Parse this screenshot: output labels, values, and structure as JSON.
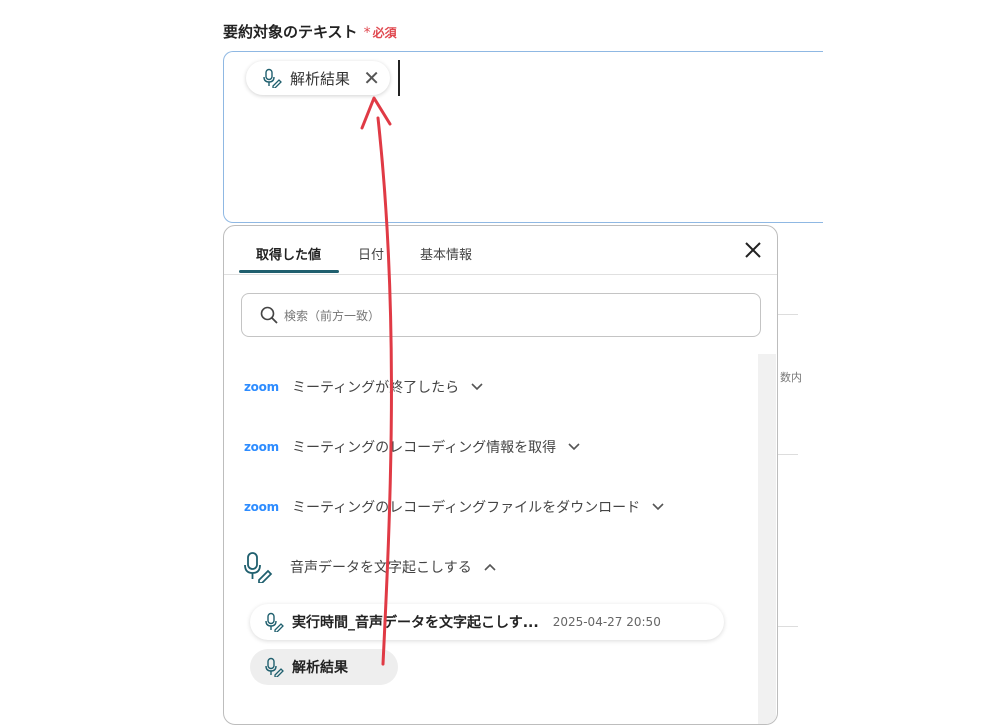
{
  "field": {
    "label": "要約対象のテキスト",
    "required_star": "*",
    "required_text": "必須",
    "chip_label": "解析結果"
  },
  "background": {
    "partial_text": "数内"
  },
  "panel": {
    "tabs": [
      {
        "label": "取得した値",
        "active": true
      },
      {
        "label": "日付",
        "active": false
      },
      {
        "label": "基本情報",
        "active": false
      }
    ],
    "search_placeholder": "検索（前方一致）",
    "groups": [
      {
        "logo": "zoom",
        "label": "ミーティングが終了したら",
        "expanded": false
      },
      {
        "logo": "zoom",
        "label": "ミーティングのレコーディング情報を取得",
        "expanded": false
      },
      {
        "logo": "zoom",
        "label": "ミーティングのレコーディングファイルをダウンロード",
        "expanded": false
      },
      {
        "logo": "mic-pen-icon",
        "label": "音声データを文字起こしする",
        "expanded": true
      }
    ],
    "items": [
      {
        "label": "実行時間_音声データを文字起こしす...",
        "timestamp": "2025-04-27 20:50"
      },
      {
        "label": "解析結果"
      }
    ]
  },
  "colors": {
    "accent": "#1f5f6e",
    "required": "#e0484f",
    "arrow": "#e03a45",
    "zoom": "#2d8cff",
    "field_border": "#8fb8e3"
  }
}
